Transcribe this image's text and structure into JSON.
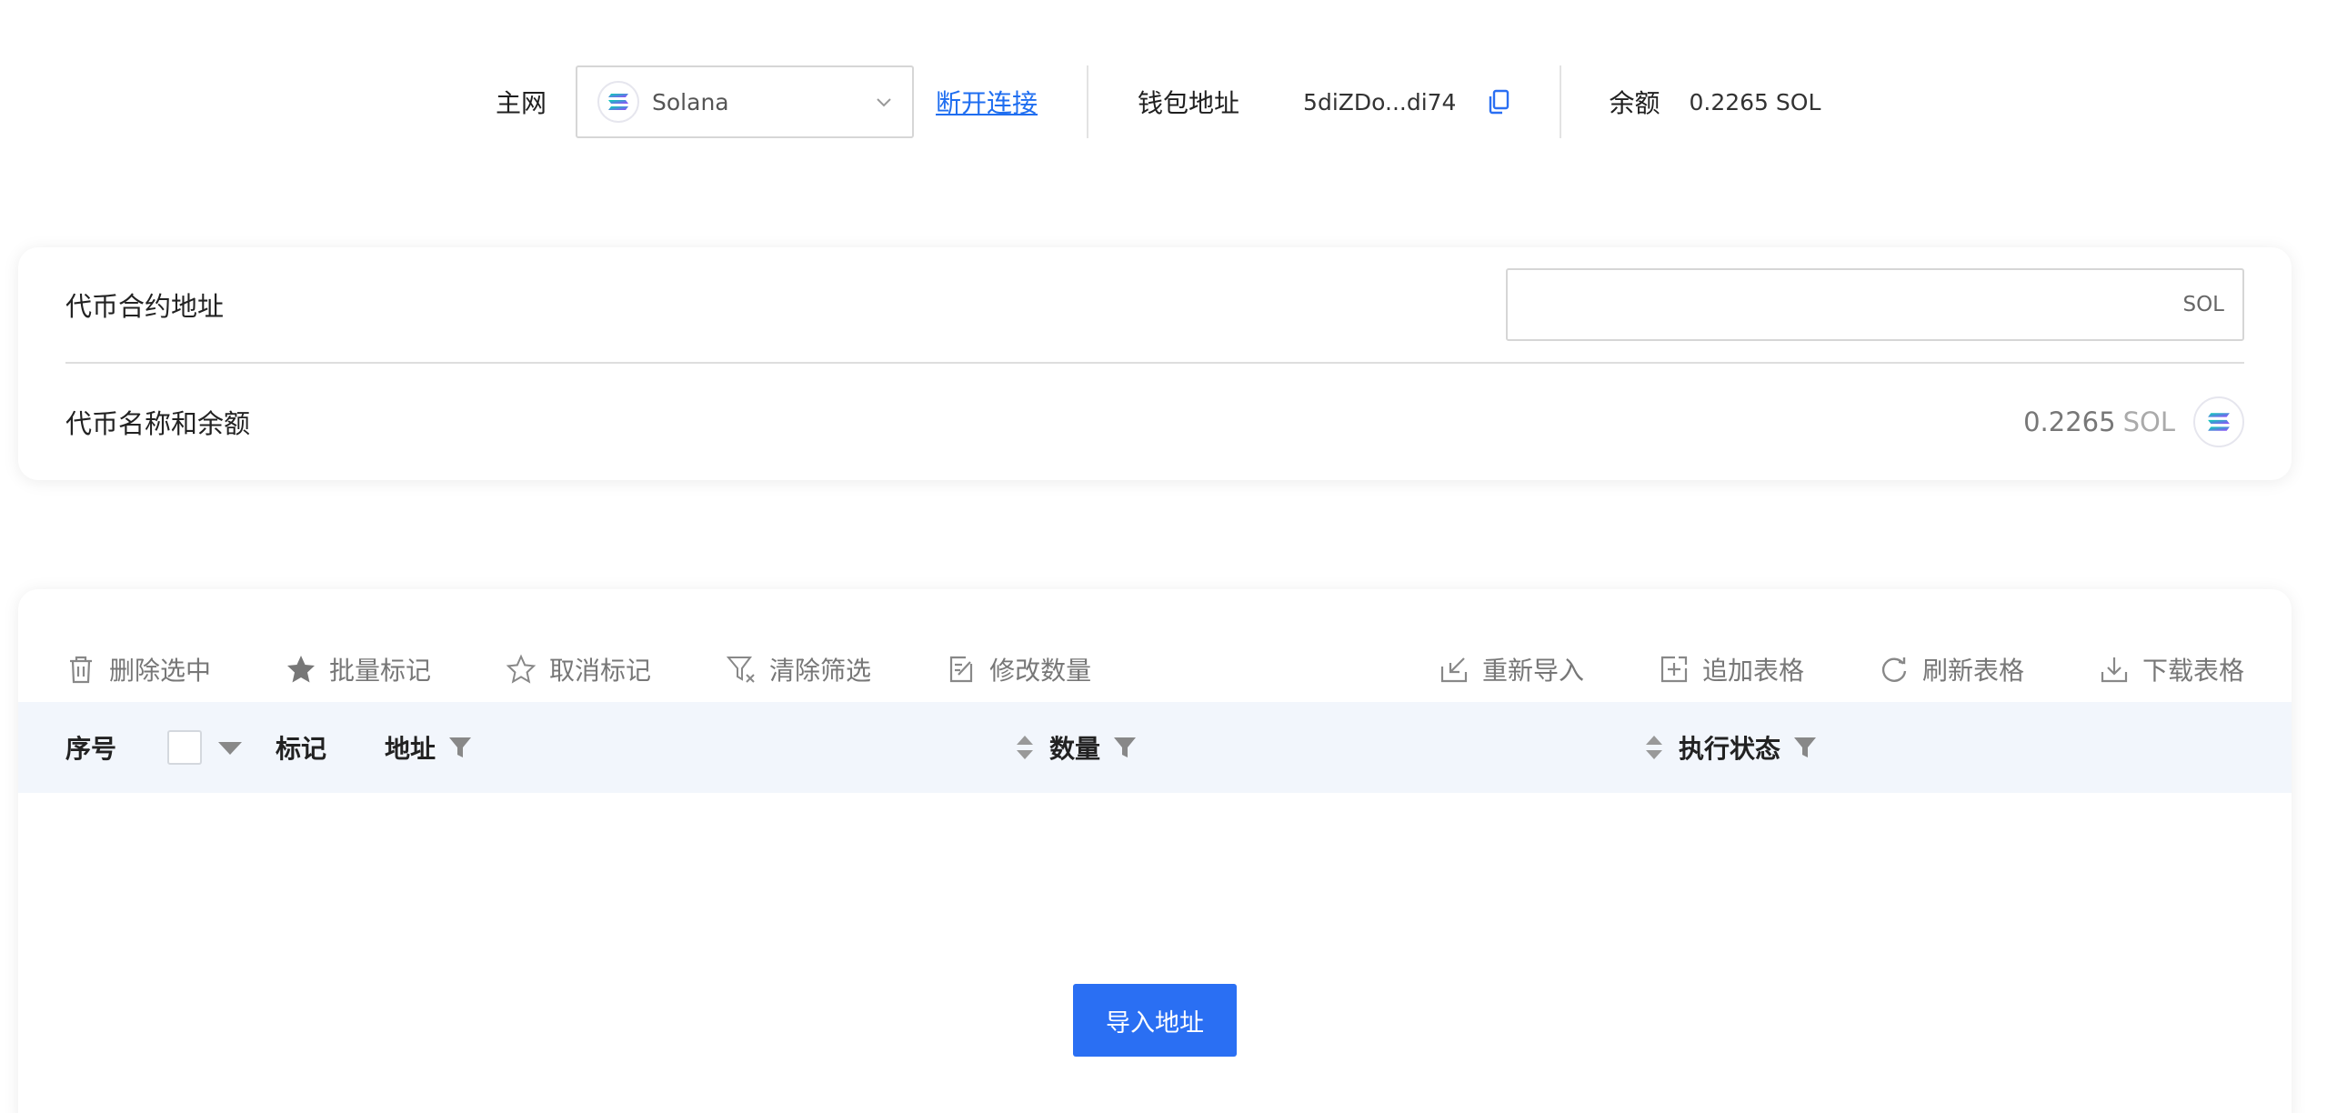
{
  "header": {
    "network_label": "主网",
    "network_value": "Solana",
    "disconnect_label": "断开连接",
    "wallet_label": "钱包地址",
    "wallet_address": "5diZDo...di74",
    "balance_label": "余额",
    "balance_value": "0.2265 SOL"
  },
  "token": {
    "contract_label": "代币合约地址",
    "contract_value": "",
    "contract_suffix": "SOL",
    "name_balance_label": "代币名称和余额",
    "balance_amount": "0.2265",
    "balance_unit": "SOL"
  },
  "toolbar": {
    "delete_selected": "删除选中",
    "batch_mark": "批量标记",
    "unmark": "取消标记",
    "clear_filter": "清除筛选",
    "edit_quantity": "修改数量",
    "reimport": "重新导入",
    "append_table": "追加表格",
    "refresh_table": "刷新表格",
    "download_table": "下载表格"
  },
  "table": {
    "columns": {
      "index": "序号",
      "mark": "标记",
      "address": "地址",
      "quantity": "数量",
      "status": "执行状态"
    }
  },
  "empty": {
    "import_button": "导入地址"
  },
  "colors": {
    "accent": "#2a6ff3",
    "link": "#1f6ef0",
    "header_bg": "#f2f6fc"
  },
  "icons": {
    "network": "solana-logo-icon",
    "copy": "copy-icon",
    "delete": "trash-icon",
    "batch_mark": "star-filled-icon",
    "unmark": "star-outline-icon",
    "clear_filter": "filter-clear-icon",
    "edit": "edit-icon",
    "reimport": "import-icon",
    "append": "add-box-icon",
    "refresh": "refresh-icon",
    "download": "download-icon"
  }
}
